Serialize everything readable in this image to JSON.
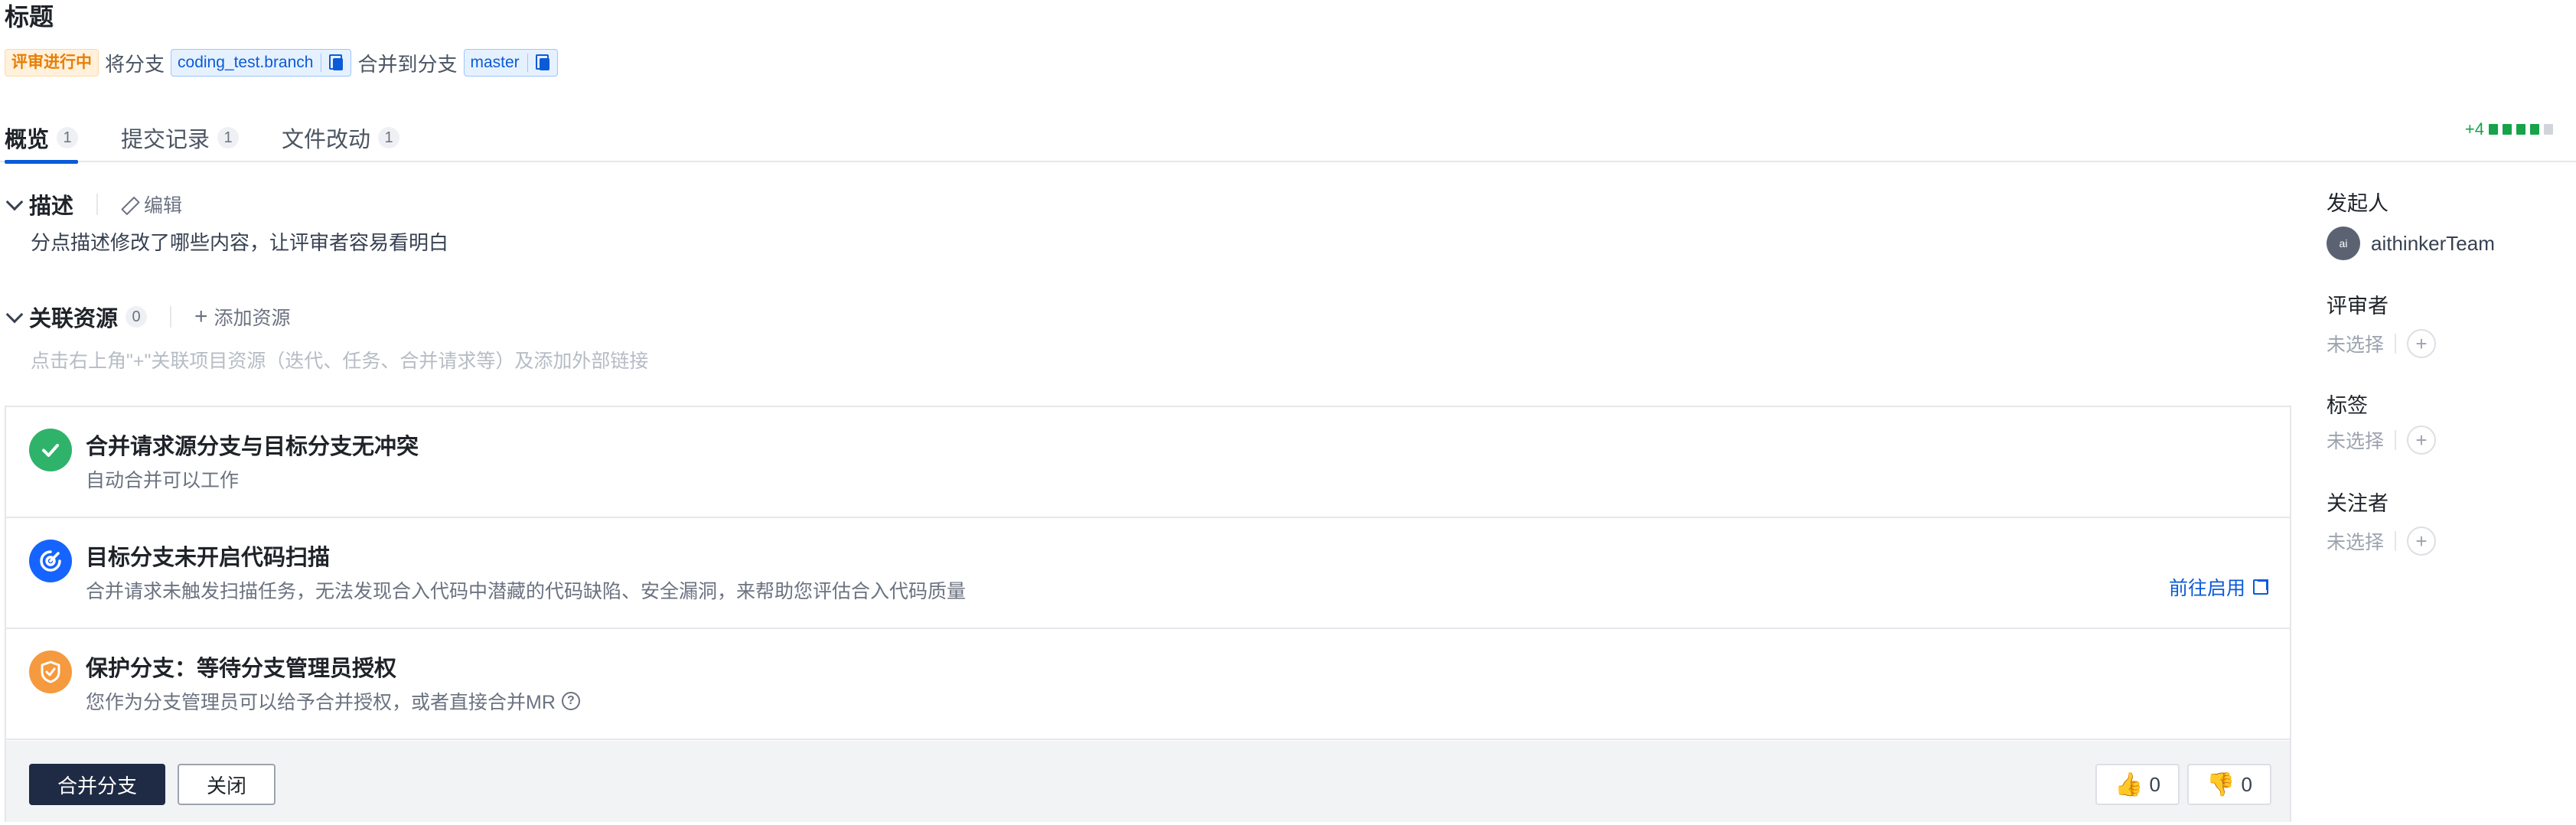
{
  "header": {
    "title": "标题",
    "status_badge": "评审进行中",
    "from_prefix": "将分支",
    "source_branch": "coding_test.branch",
    "merge_into": "合并到分支",
    "target_branch": "master"
  },
  "tabs": [
    {
      "label": "概览",
      "count": "1",
      "active": true
    },
    {
      "label": "提交记录",
      "count": "1",
      "active": false
    },
    {
      "label": "文件改动",
      "count": "1",
      "active": false
    }
  ],
  "diffstat": {
    "additions": "+4",
    "color": "#16a34a"
  },
  "description": {
    "heading": "描述",
    "edit_label": "编辑",
    "text": "分点描述修改了哪些内容，让评审者容易看明白"
  },
  "resources": {
    "heading": "关联资源",
    "count": "0",
    "add_label": "添加资源",
    "hint": "点击右上角\"+\"关联项目资源（迭代、任务、合并请求等）及添加外部链接"
  },
  "checks": [
    {
      "icon": "check-circle-icon",
      "color": "#2fb36b",
      "title": "合并请求源分支与目标分支无冲突",
      "subtitle": "自动合并可以工作"
    },
    {
      "icon": "scan-icon",
      "color": "#1664ff",
      "title": "目标分支未开启代码扫描",
      "subtitle": "合并请求未触发扫描任务，无法发现合入代码中潜藏的代码缺陷、安全漏洞，来帮助您评估合入代码质量",
      "link": "前往启用"
    },
    {
      "icon": "shield-icon",
      "color": "#f59a3e",
      "title": "保护分支：等待分支管理员授权",
      "subtitle": "您作为分支管理员可以给予合并授权，或者直接合并MR"
    }
  ],
  "actions": {
    "merge_label": "合并分支",
    "close_label": "关闭",
    "upvote_count": "0",
    "downvote_count": "0"
  },
  "sidebar": {
    "initiator_label": "发起人",
    "initiator_avatar": "ai",
    "initiator_name": "aithinkerTeam",
    "reviewers_label": "评审者",
    "reviewers_value": "未选择",
    "labels_label": "标签",
    "labels_value": "未选择",
    "watchers_label": "关注者",
    "watchers_value": "未选择"
  }
}
